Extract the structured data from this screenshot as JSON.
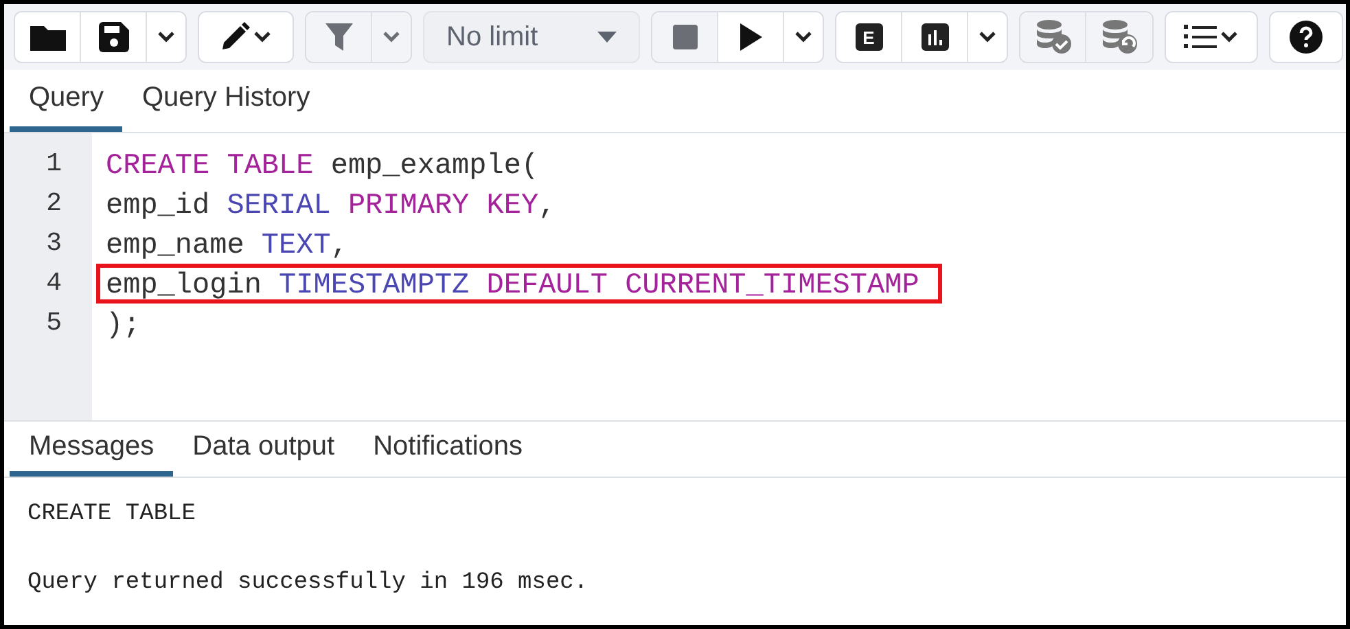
{
  "toolbar": {
    "groups": [
      {
        "buttons": [
          {
            "kind": "folder",
            "disabled": false
          },
          {
            "kind": "save",
            "disabled": false
          },
          {
            "kind": "caret",
            "disabled": false
          }
        ]
      },
      {
        "buttons": [
          {
            "kind": "pencil-caret",
            "disabled": false
          }
        ]
      },
      {
        "buttons": [
          {
            "kind": "filter",
            "disabled": true
          },
          {
            "kind": "caret",
            "disabled": true
          }
        ]
      },
      {
        "buttons": [
          {
            "kind": "select",
            "value": "No limit",
            "disabled": true
          }
        ]
      },
      {
        "buttons": [
          {
            "kind": "stop",
            "disabled": true
          },
          {
            "kind": "play",
            "disabled": false
          },
          {
            "kind": "caret",
            "disabled": false
          }
        ]
      },
      {
        "buttons": [
          {
            "kind": "letter",
            "label": "E",
            "disabled": false
          },
          {
            "kind": "chart",
            "disabled": false
          },
          {
            "kind": "caret",
            "disabled": false
          }
        ]
      },
      {
        "buttons": [
          {
            "kind": "db-check",
            "disabled": true
          },
          {
            "kind": "db-undo",
            "disabled": true
          }
        ]
      },
      {
        "buttons": [
          {
            "kind": "list-caret",
            "disabled": false
          }
        ]
      },
      {
        "buttons": [
          {
            "kind": "help",
            "disabled": false
          }
        ]
      }
    ]
  },
  "editor_tabs": [
    {
      "label": "Query",
      "selected": true
    },
    {
      "label": "Query History",
      "selected": false
    }
  ],
  "editor": {
    "lines": [
      {
        "number": "1",
        "highlighted": false,
        "tokens": [
          {
            "kind": "keyword",
            "text": "CREATE TABLE"
          },
          {
            "kind": "plain",
            "text": " emp_example("
          }
        ]
      },
      {
        "number": "2",
        "highlighted": false,
        "tokens": [
          {
            "kind": "plain",
            "text": "emp_id "
          },
          {
            "kind": "type",
            "text": "SERIAL"
          },
          {
            "kind": "keyword",
            "text": " PRIMARY KEY"
          },
          {
            "kind": "plain",
            "text": ","
          }
        ]
      },
      {
        "number": "3",
        "highlighted": false,
        "tokens": [
          {
            "kind": "plain",
            "text": "emp_name "
          },
          {
            "kind": "type",
            "text": "TEXT"
          },
          {
            "kind": "plain",
            "text": ","
          }
        ]
      },
      {
        "number": "4",
        "highlighted": true,
        "tokens": [
          {
            "kind": "plain",
            "text": "emp_login "
          },
          {
            "kind": "type",
            "text": "TIMESTAMPTZ"
          },
          {
            "kind": "keyword",
            "text": " DEFAULT CURRENT_TIMESTAMP"
          }
        ]
      },
      {
        "number": "5",
        "highlighted": false,
        "tokens": [
          {
            "kind": "plain",
            "text": ");"
          }
        ]
      }
    ]
  },
  "result_tabs": [
    {
      "label": "Messages",
      "selected": true
    },
    {
      "label": "Data output",
      "selected": false
    },
    {
      "label": "Notifications",
      "selected": false
    }
  ],
  "messages": [
    "CREATE TABLE",
    "Query returned successfully in 196 msec."
  ]
}
